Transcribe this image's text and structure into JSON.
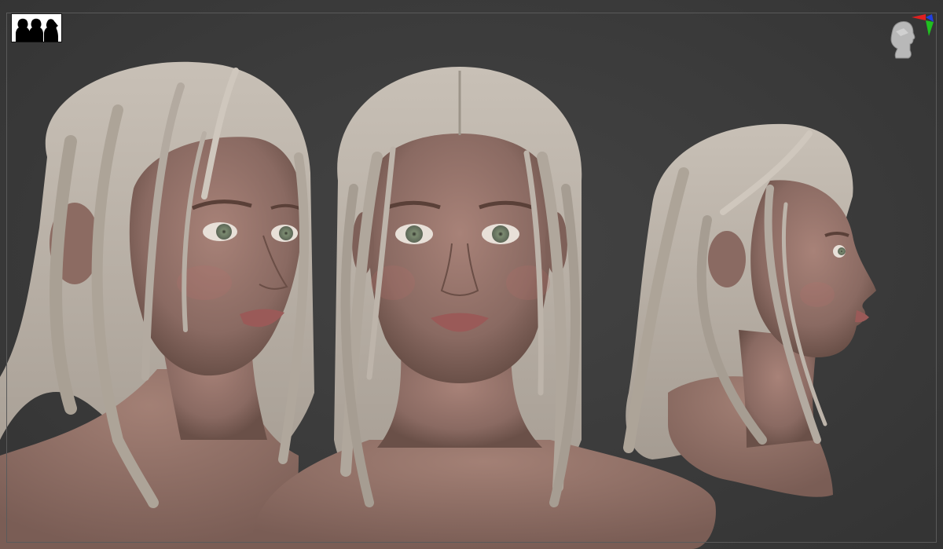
{
  "app": {
    "viewport_background": "#3a3a3a"
  },
  "toolbar": {
    "logo_icon": "three-heads-silhouette-icon"
  },
  "navigation": {
    "orientation_icon": "head-orientation-cube-icon",
    "axis_colors": {
      "x": "#e02020",
      "y": "#20c020",
      "z": "#2040e0"
    }
  },
  "scene": {
    "views": [
      "three-quarter-view",
      "front-view",
      "profile-view"
    ],
    "skin_color": "#9c7a70",
    "hair_color": "#b9b0a6"
  }
}
